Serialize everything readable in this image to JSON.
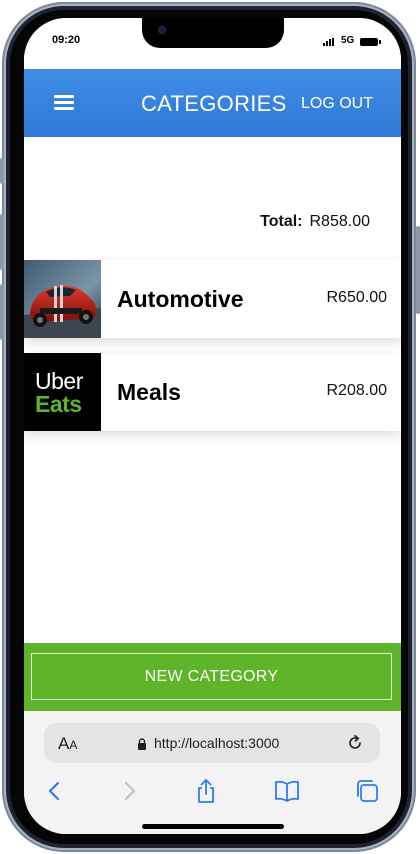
{
  "status_bar": {
    "time": "09:20",
    "network": "5G"
  },
  "header": {
    "title": "CATEGORIES",
    "logout_label": "LOG OUT"
  },
  "summary": {
    "total_label": "Total:",
    "total_value": "R858.00"
  },
  "categories": [
    {
      "name": "Automotive",
      "amount": "R650.00",
      "image": "red sports car photo"
    },
    {
      "name": "Meals",
      "amount": "R208.00",
      "image": "Uber Eats logo",
      "logo_text": [
        "Uber",
        "Eats"
      ]
    }
  ],
  "actions": {
    "new_category_label": "NEW CATEGORY"
  },
  "browser": {
    "aa_large": "A",
    "aa_small": "A",
    "url": "http://localhost:3000"
  },
  "colors": {
    "header": "#3a86e2",
    "new_category_bar": "#5fb52a",
    "uber_eats_green": "#5fb52a"
  },
  "icons": [
    "hamburger-menu-icon",
    "lock-icon",
    "reload-icon",
    "back-icon",
    "forward-icon",
    "share-icon",
    "bookmarks-icon",
    "tabs-icon"
  ]
}
